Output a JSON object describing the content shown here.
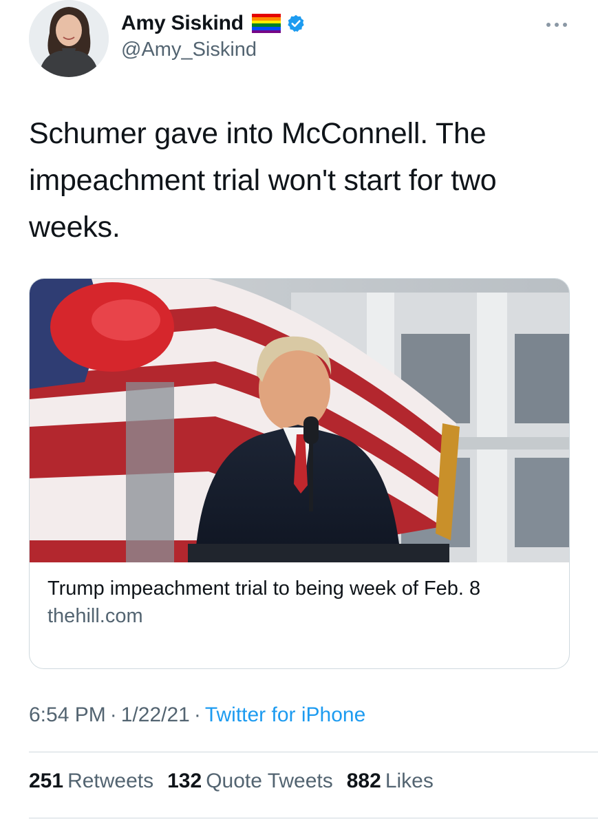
{
  "author": {
    "display_name": "Amy Siskind",
    "handle": "@Amy_Siskind",
    "flag_icon": "rainbow-flag-emoji",
    "verified_icon": "verified-badge-icon"
  },
  "tweet": {
    "text": "Schumer gave into McConnell.  The impeachment trial won't start for two weeks."
  },
  "link_card": {
    "title": "Trump impeachment trial to being week of Feb. 8",
    "domain": "thehill.com"
  },
  "meta": {
    "time": "6:54 PM",
    "separator": "·",
    "date": "1/22/21",
    "source": "Twitter for iPhone"
  },
  "stats": {
    "retweets_count": "251",
    "retweets_label": "Retweets",
    "quotes_count": "132",
    "quotes_label": "Quote Tweets",
    "likes_count": "882",
    "likes_label": "Likes"
  },
  "colors": {
    "text": "#0f1419",
    "secondary": "#536471",
    "link": "#1d9bf0",
    "border": "#cfd9de"
  }
}
